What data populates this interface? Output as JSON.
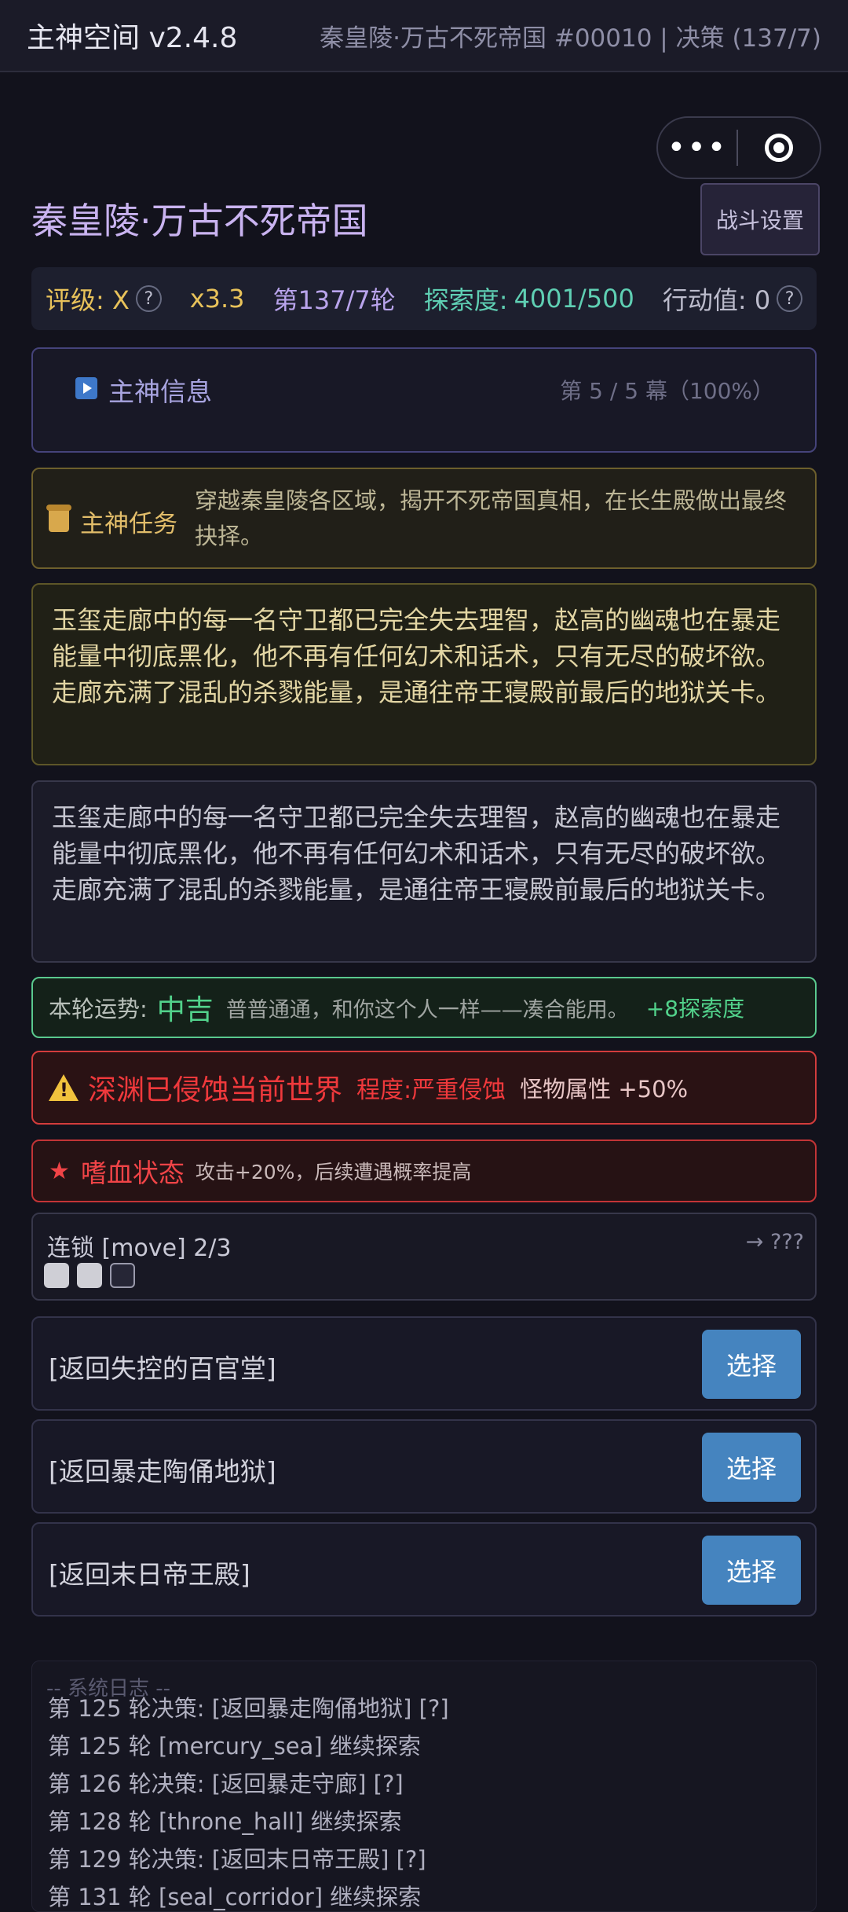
{
  "header": {
    "app_title": "主神空间 v2.4.8",
    "status": "秦皇陵·万古不死帝国 #00010 | 决策 (137/7)"
  },
  "capsule": {
    "more_icon": "more-dots-icon",
    "target_icon": "target-icon"
  },
  "world": {
    "title": "秦皇陵·万古不死帝国",
    "battle_settings": "战斗设置"
  },
  "stats": {
    "rating_label": "评级: X",
    "multiplier": "x3.3",
    "round": "第137/7轮",
    "exploration_label": "探索度:",
    "exploration_value": "4001/500",
    "action_label": "行动值: 0",
    "help": "?"
  },
  "info": {
    "label": "主神信息",
    "progress": "第 5 / 5 幕（100%）"
  },
  "task": {
    "label": "主神任务",
    "text": "穿越秦皇陵各区域，揭开不死帝国真相，在长生殿做出最终抉择。"
  },
  "story": {
    "highlight": "玉玺走廊中的每一名守卫都已完全失去理智，赵高的幽魂也在暴走能量中彻底黑化，他不再有任何幻术和话术，只有无尽的破坏欲。走廊充满了混乱的杀戮能量，是通往帝王寝殿前最后的地狱关卡。",
    "body": "玉玺走廊中的每一名守卫都已完全失去理智，赵高的幽魂也在暴走能量中彻底黑化，他不再有任何幻术和话术，只有无尽的破坏欲。走廊充满了混乱的杀戮能量，是通往帝王寝殿前最后的地狱关卡。"
  },
  "fortune": {
    "label": "本轮运势:",
    "value": "中吉",
    "desc": "普普通通，和你这个人一样——凑合能用。",
    "bonus": "+8探索度"
  },
  "abyss": {
    "title": "深渊已侵蚀当前世界",
    "degree": "程度:严重侵蚀",
    "effect": "怪物属性 +50%"
  },
  "blood": {
    "title": "嗜血状态",
    "desc": "攻击+20%，后续遭遇概率提高"
  },
  "chain": {
    "label": "连锁 [move] 2/3",
    "next": "→ ???",
    "progress": 2,
    "total": 3
  },
  "choices": [
    {
      "label": "[返回失控的百官堂]",
      "button": "选择"
    },
    {
      "label": "[返回暴走陶俑地狱]",
      "button": "选择"
    },
    {
      "label": "[返回末日帝王殿]",
      "button": "选择"
    }
  ],
  "log": {
    "header": "-- 系统日志 --",
    "lines": [
      "第 125 轮决策: [返回暴走陶俑地狱] [?]",
      "第 125 轮 [mercury_sea] 继续探索",
      "第 126 轮决策: [返回暴走守廊] [?]",
      "第 128 轮 [throne_hall] 继续探索",
      "第 129 轮决策: [返回末日帝王殿] [?]",
      "第 131 轮 [seal_corridor] 继续探索"
    ]
  },
  "colors": {
    "background": "#12121c",
    "accent_purple": "#c9b3f0",
    "gold": "#e2bd6a",
    "green": "#52d28b",
    "red": "#f0393c",
    "button_blue": "#4584bf"
  }
}
